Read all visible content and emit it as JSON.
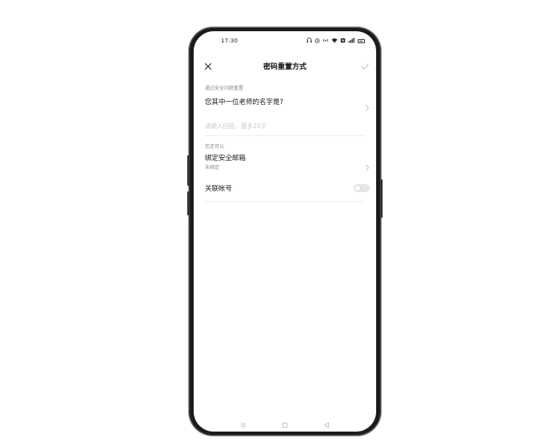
{
  "status_bar": {
    "time": "17:30",
    "icons": [
      "headset-icon",
      "alarm-icon",
      "hotspot-icon",
      "wifi-icon",
      "nfc-icon",
      "signal-icon",
      "battery-icon"
    ]
  },
  "header": {
    "title": "密码重置方式",
    "close_icon": "close-icon",
    "confirm_icon": "check-icon"
  },
  "security_question": {
    "section_label": "通过安全问题重置",
    "question": "您其中一位老师的名字是?",
    "answer_value": "",
    "answer_placeholder": "请输入回答，最多20字"
  },
  "alternatives": {
    "section_label": "您还可以",
    "items": [
      {
        "title": "绑定安全邮箱",
        "subtitle": "未绑定",
        "control": "chevron"
      },
      {
        "title": "关联帐号",
        "control": "toggle",
        "enabled": false
      }
    ]
  },
  "nav_bar": {
    "icons": [
      "menu-icon",
      "home-icon",
      "back-icon"
    ]
  },
  "colors": {
    "text_primary": "#1a1a1a",
    "text_secondary": "#8a8a8a",
    "placeholder": "#c9c9c9",
    "phone_frame": "#1b1b1b"
  }
}
